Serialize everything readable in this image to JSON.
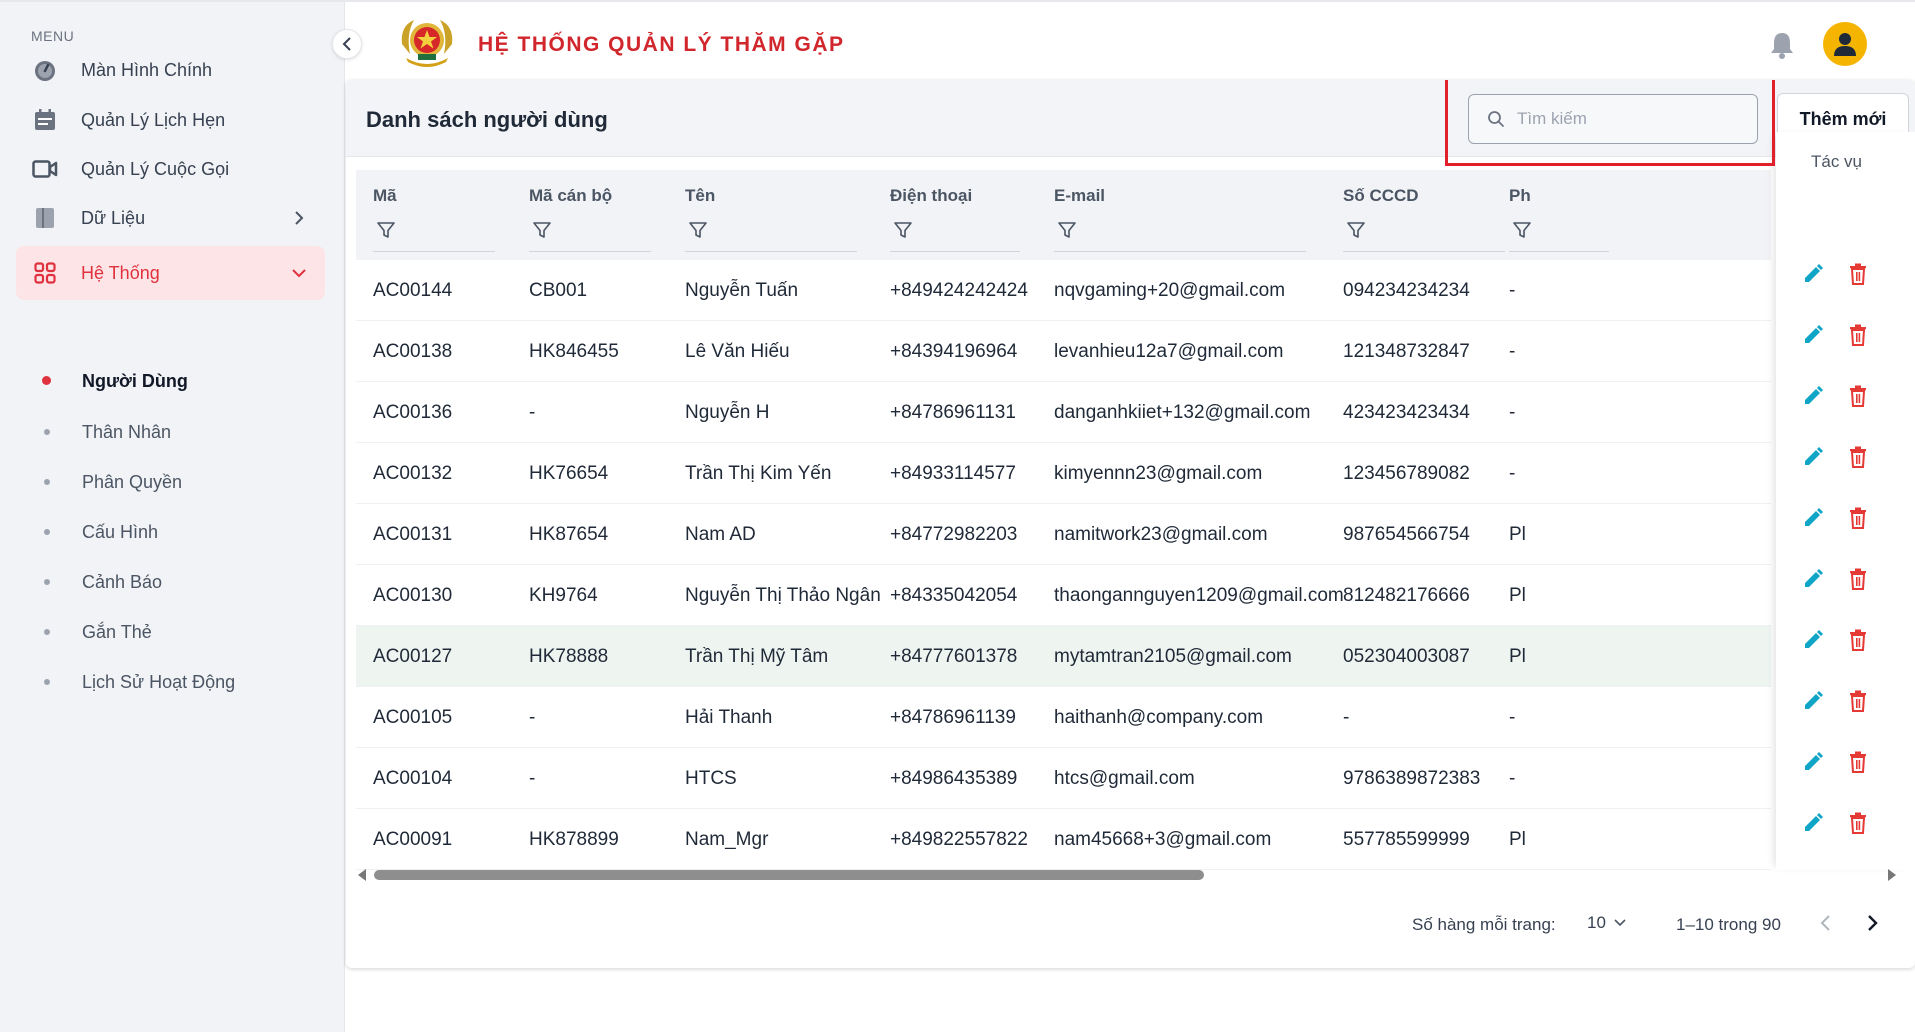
{
  "sidebar": {
    "menu_label": "MENU",
    "items": [
      {
        "label": "Màn Hình Chính",
        "icon": "dashboard-icon"
      },
      {
        "label": "Quản Lý Lịch Hẹn",
        "icon": "calendar-icon"
      },
      {
        "label": "Quản Lý Cuộc Gọi",
        "icon": "video-camera-icon"
      },
      {
        "label": "Dữ Liệu",
        "icon": "book-icon"
      },
      {
        "label": "Hệ Thống",
        "icon": "grid-icon"
      }
    ],
    "subitems": [
      {
        "label": "Người Dùng"
      },
      {
        "label": "Thân Nhân"
      },
      {
        "label": "Phân Quyền"
      },
      {
        "label": "Cấu Hình"
      },
      {
        "label": "Cảnh Báo"
      },
      {
        "label": "Gắn Thẻ"
      },
      {
        "label": "Lịch Sử Hoạt Động"
      }
    ],
    "active_item": "Hệ Thống",
    "active_subitem": "Người Dùng"
  },
  "header": {
    "title": "HỆ THỐNG QUẢN LÝ THĂM GẶP"
  },
  "card": {
    "title": "Danh sách người dùng",
    "search_placeholder": "Tìm kiếm",
    "search_value": "",
    "add_button": "Thêm mới"
  },
  "table": {
    "columns": [
      "Mã",
      "Mã cán bộ",
      "Tên",
      "Điện thoại",
      "E-mail",
      "Số CCCD",
      "Ph"
    ],
    "actions_header": "Tác vụ",
    "rows": [
      [
        "AC00144",
        "CB001",
        "Nguyễn Tuấn",
        "+849424242424",
        "nqvgaming+20@gmail.com",
        "094234234234",
        "-"
      ],
      [
        "AC00138",
        "HK846455",
        "Lê Văn Hiếu",
        "+84394196964",
        "levanhieu12a7@gmail.com",
        "121348732847",
        "-"
      ],
      [
        "AC00136",
        "-",
        "Nguyễn H",
        "+84786961131",
        "danganhkiiet+132@gmail.com",
        "423423423434",
        "-"
      ],
      [
        "AC00132",
        "HK76654",
        "Trần Thị Kim Yến",
        "+84933114577",
        "kimyennn23@gmail.com",
        "123456789082",
        "-"
      ],
      [
        "AC00131",
        "HK87654",
        "Nam AD",
        "+84772982203",
        "namitwork23@gmail.com",
        "987654566754",
        "Pl"
      ],
      [
        "AC00130",
        "KH9764",
        "Nguyễn Thị Thảo Ngân",
        "+84335042054",
        "thaongannguyen1209@gmail.com",
        "812482176666",
        "Pl"
      ],
      [
        "AC00127",
        "HK78888",
        "Trần Thị Mỹ Tâm",
        "+84777601378",
        "mytamtran2105@gmail.com",
        "052304003087",
        "Pl"
      ],
      [
        "AC00105",
        "-",
        "Hải Thanh",
        "+84786961139",
        "haithanh@company.com",
        "-",
        "-"
      ],
      [
        "AC00104",
        "-",
        "HTCS",
        "+84986435389",
        "htcs@gmail.com",
        "9786389872383",
        "-"
      ],
      [
        "AC00091",
        "HK878899",
        "Nam_Mgr",
        "+849822557822",
        "nam45668+3@gmail.com",
        "557785599999",
        "Pl"
      ]
    ],
    "highlighted_row": 6
  },
  "pagination": {
    "rows_per_page_label": "Số hàng mỗi trang:",
    "rows_per_page": "10",
    "range": "1–10 trong 90"
  },
  "colors": {
    "accent": "#e0313f",
    "title_red": "#d1262c",
    "edit": "#0ea5c6",
    "delete": "#e53935",
    "avatar": "#f4b400"
  }
}
